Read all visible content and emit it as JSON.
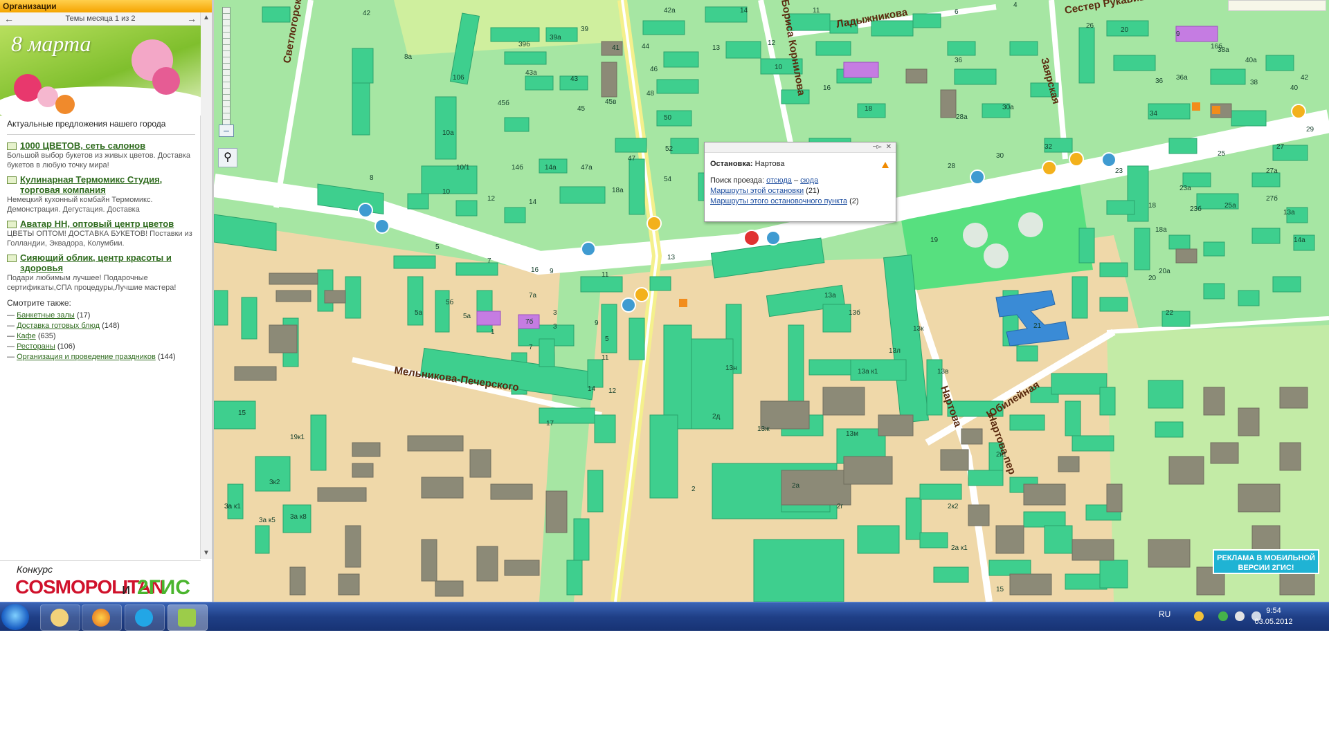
{
  "sidebar": {
    "header": "Организации",
    "pager": "Темы месяца 1 из 2",
    "banner_title": "8 марта",
    "intro": "Актуальные предложения нашего города",
    "orgs": [
      {
        "title": "1000 ЦВЕТОВ, сеть салонов",
        "desc": "Большой выбор букетов из живых цветов. Доставка букетов в любую точку мира!"
      },
      {
        "title": "Кулинарная Термомикс Студия, торговая компания",
        "desc": "Немецкий кухонный комбайн Термомикс. Демонстрация. Дегустация. Доставка"
      },
      {
        "title": "Аватар НН, оптовый центр цветов",
        "desc": "ЦВЕТЫ ОПТОМ! ДОСТАВКА БУКЕТОВ! Поставки из Голландии, Эквадора, Колумбии."
      },
      {
        "title": "Сияющий облик, центр красоты и здоровья",
        "desc": "Подари любимым лучшее! Подарочные сертификаты,СПА процедуры,Лучшие мастера!"
      }
    ],
    "also_label": "Смотрите также:",
    "also": [
      {
        "link": "Банкетные залы",
        "count": "(17)"
      },
      {
        "link": "Доставка готовых блюд",
        "count": "(148)"
      },
      {
        "link": "Кафе",
        "count": "(635)"
      },
      {
        "link": "Рестораны",
        "count": "(106)"
      },
      {
        "link": "Организация и проведение праздников",
        "count": "(144)"
      }
    ],
    "contest": {
      "line1": "Конкурс",
      "brand": "COSMOPOLITAN",
      "and": "и",
      "partner": "2ГИС"
    }
  },
  "map": {
    "streets": [
      "Светлогорская",
      "Ладыжникова",
      "Сестер Рукавишниковых",
      "Заярская",
      "Мельникова-Печерского",
      "Нартова",
      "Нартова пер",
      "Юбилейная",
      "Бориса Корнилова"
    ],
    "house_labels": [
      "42",
      "42а",
      "14",
      "11",
      "12",
      "13",
      "10",
      "16",
      "18",
      "6",
      "4",
      "9",
      "26",
      "20",
      "36",
      "39б",
      "39а",
      "39",
      "41",
      "44",
      "46",
      "48",
      "50",
      "52",
      "54",
      "16б",
      "38",
      "40",
      "42",
      "43а",
      "43",
      "45б",
      "45",
      "45в",
      "47",
      "47а",
      "14б",
      "14а",
      "18а",
      "8",
      "8а",
      "106",
      "10а",
      "10",
      "10/1",
      "12",
      "14",
      "5",
      "5а",
      "7",
      "9",
      "11",
      "13",
      "13а",
      "13к",
      "13б",
      "13м",
      "13ж",
      "13н",
      "13л",
      "13в",
      "13а к1",
      "2",
      "2д",
      "2а",
      "2г",
      "2к1",
      "2к2",
      "2а к1",
      "15",
      "19",
      "21",
      "23",
      "25",
      "27",
      "29",
      "23а",
      "23б",
      "25а",
      "27а",
      "27б",
      "13а",
      "14а",
      "18",
      "18а",
      "20",
      "20а",
      "22",
      "30",
      "32",
      "28",
      "28а",
      "30а",
      "34",
      "36",
      "36а",
      "38а",
      "40а",
      "3",
      "5а",
      "5б",
      "7",
      "7а",
      "7б",
      "9",
      "11",
      "3",
      "5",
      "1",
      "12",
      "14",
      "16",
      "17",
      "19к1",
      "15",
      "3а",
      "3а к5",
      "3а к8",
      "3к2",
      "3а к1"
    ],
    "popup": {
      "stop_label": "Остановка:",
      "stop_name": "Нартова",
      "search_label": "Поиск проезда:",
      "from": "отсюда",
      "dash": "–",
      "to": "сюда",
      "routes_stop": "Маршруты этой остановки",
      "routes_stop_count": "(21)",
      "routes_point": "Маршруты этого остановочного пункта",
      "routes_point_count": "(2)"
    },
    "ad": "РЕКЛАМА В МОБИЛЬНОЙ ВЕРСИИ 2ГИС!"
  },
  "taskbar": {
    "lang": "RU",
    "time": "9:54",
    "date": "03.05.2012"
  },
  "colors": {
    "park": "#a6e6a3",
    "building": "#3ecf8e",
    "road": "#ffffff",
    "main_road": "#f4f08c",
    "industrial": "#efd8a9",
    "accent_link": "#2f6b1e"
  }
}
